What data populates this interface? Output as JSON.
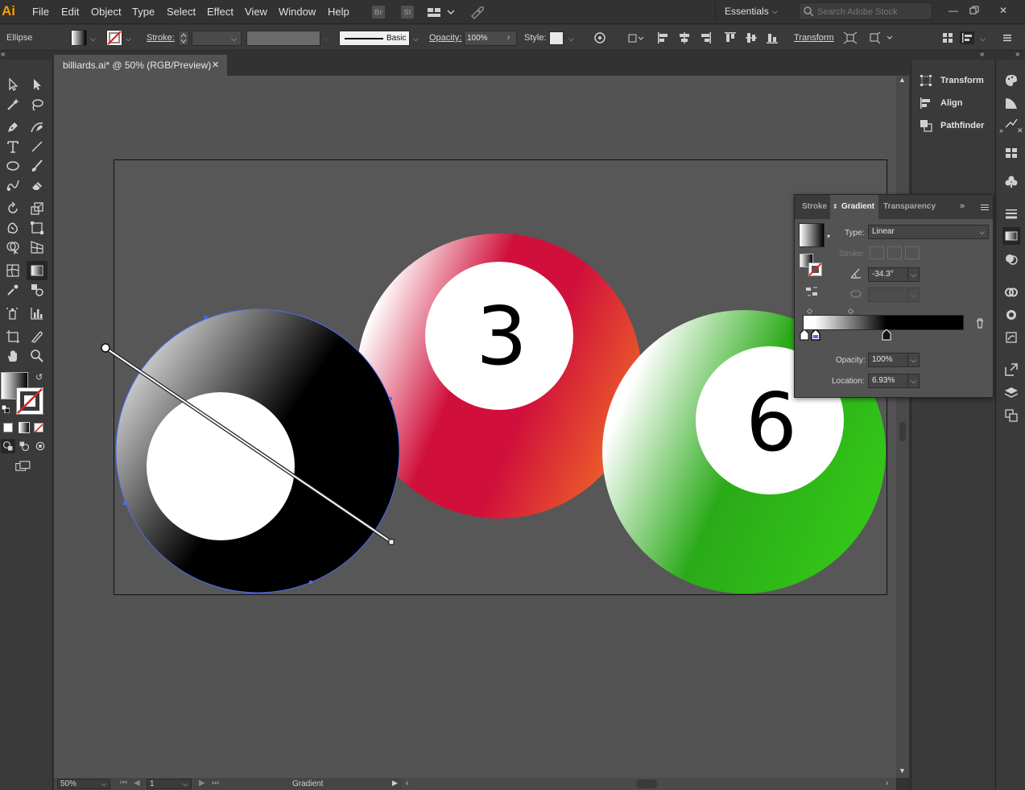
{
  "menubar": {
    "logo": "Ai",
    "items": [
      "File",
      "Edit",
      "Object",
      "Type",
      "Select",
      "Effect",
      "View",
      "Window",
      "Help"
    ],
    "bridge_badge": "Br",
    "stock_badge": "St",
    "workspace": "Essentials",
    "search_placeholder": "Search Adobe Stock"
  },
  "controlbar": {
    "object_type": "Ellipse",
    "stroke_label": "Stroke:",
    "stroke_profile": "Basic",
    "opacity_label": "Opacity:",
    "opacity_value": "100%",
    "style_label": "Style:",
    "transform_label": "Transform"
  },
  "document": {
    "tab_title": "billiards.ai* @ 50% (RGB/Preview)",
    "zoom": "50%",
    "artboard_number": "1",
    "status_text": "Gradient"
  },
  "artwork": {
    "ball_3_number": "3",
    "ball_6_number": "6"
  },
  "dock": {
    "items": [
      "Transform",
      "Align",
      "Pathfinder"
    ]
  },
  "gradient_panel": {
    "tabs": [
      "Stroke",
      "Gradient",
      "Transparency"
    ],
    "type_label": "Type:",
    "type_value": "Linear",
    "stroke_label": "Stroke:",
    "angle_value": "-34.3°",
    "opacity_label": "Opacity:",
    "opacity_value": "100%",
    "location_label": "Location:",
    "location_value": "6.93%"
  },
  "colors": {
    "accent_selection": "#4a6cf7",
    "ball_red": "#d0103a",
    "ball_orange": "#f06a28",
    "ball_green": "#2cbf16",
    "canvas_bg": "#535353"
  }
}
